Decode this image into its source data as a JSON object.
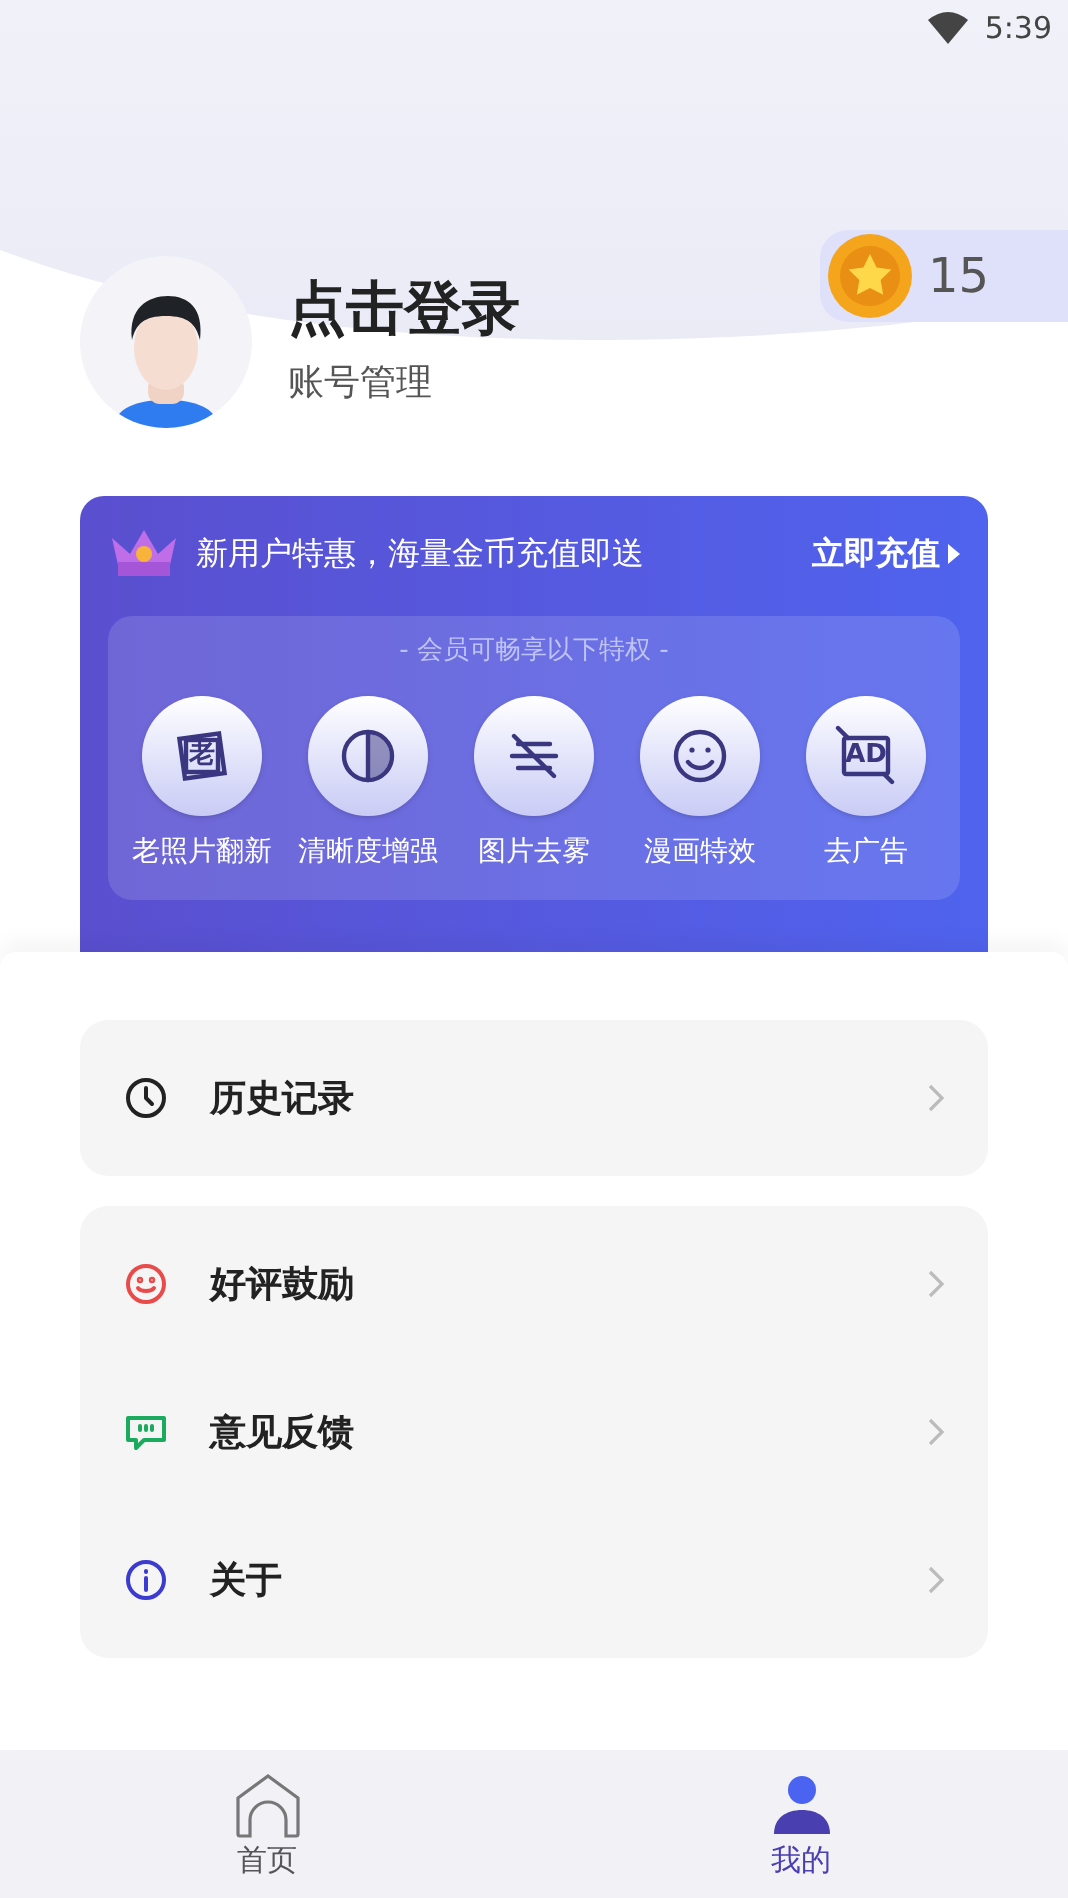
{
  "status_bar": {
    "time": "5:39"
  },
  "profile": {
    "title": "点击登录",
    "subtitle": "账号管理",
    "coins": "15"
  },
  "promo": {
    "text": "新用户特惠，海量金币充值即送",
    "action": "立即充值",
    "perks_caption": "- 会员可畅享以下特权 -",
    "perks": [
      {
        "kind": "old-photo",
        "label": "老照片翻新",
        "icon_text": "老"
      },
      {
        "kind": "contrast",
        "label": "清晰度增强"
      },
      {
        "kind": "dehaze",
        "label": "图片去雾"
      },
      {
        "kind": "smile",
        "label": "漫画特效"
      },
      {
        "kind": "no-ad",
        "label": "去广告",
        "icon_text": "AD"
      }
    ]
  },
  "menu_groups": [
    [
      {
        "kind": "history",
        "label": "历史记录"
      }
    ],
    [
      {
        "kind": "rate",
        "label": "好评鼓励"
      },
      {
        "kind": "feedback",
        "label": "意见反馈"
      },
      {
        "kind": "about",
        "label": "关于"
      }
    ]
  ],
  "tabs": [
    {
      "kind": "home",
      "label": "首页",
      "selected": false
    },
    {
      "kind": "me",
      "label": "我的",
      "selected": true
    }
  ]
}
